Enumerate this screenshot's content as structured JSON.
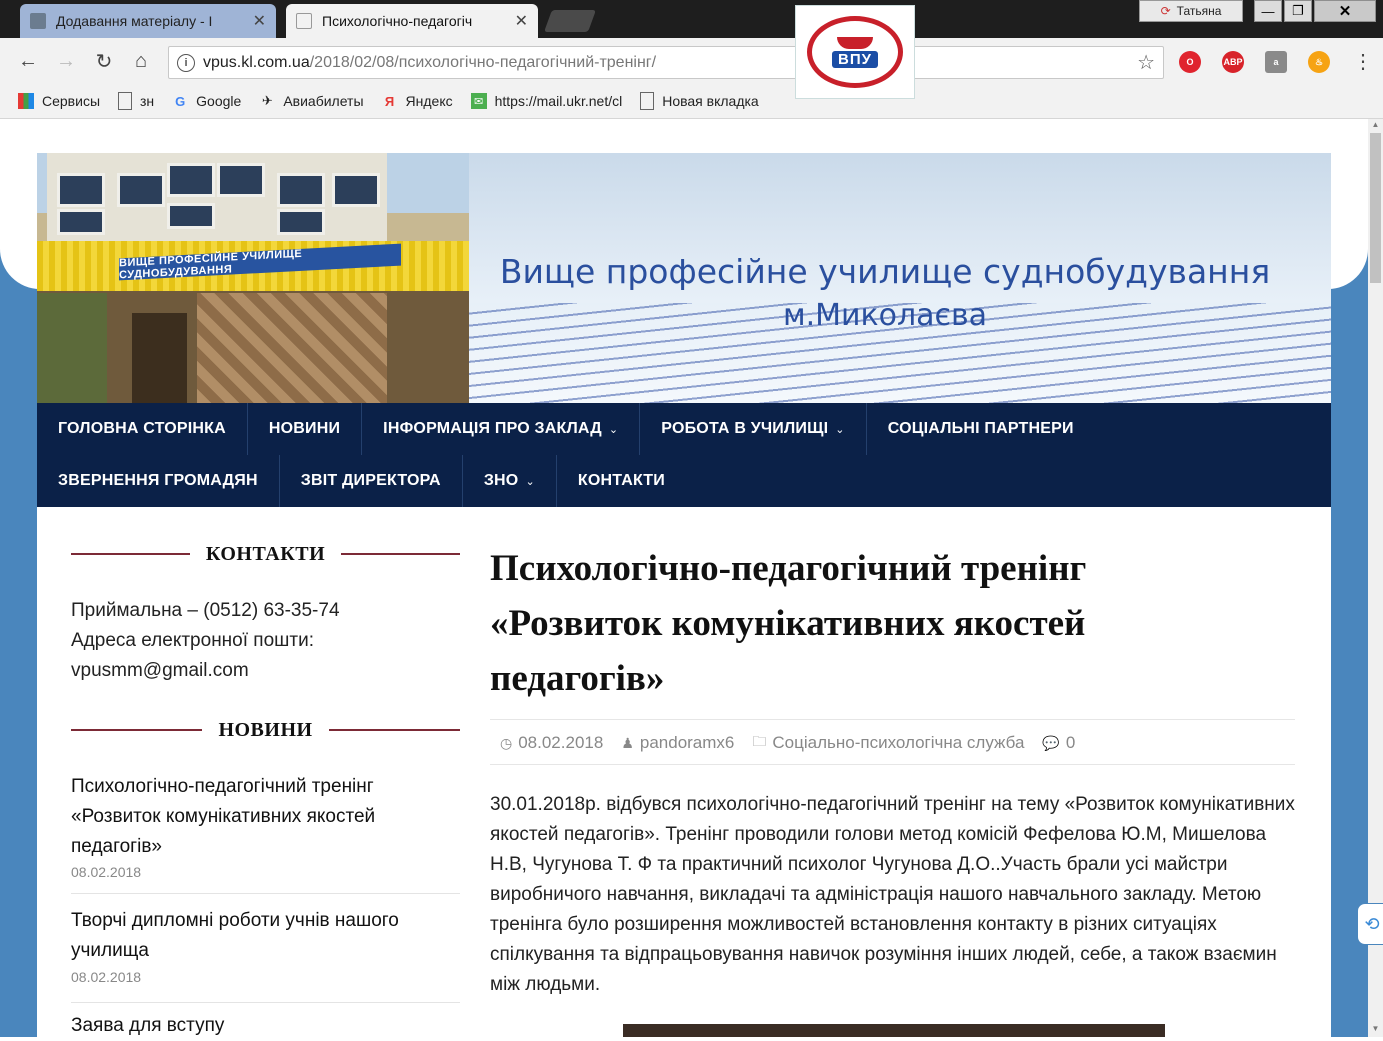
{
  "browser": {
    "tabs": [
      {
        "title": "Додавання матеріалу - І",
        "close": "✕"
      },
      {
        "title": "Психологічно-педагогіч",
        "close": "✕"
      }
    ],
    "user": "Татьяна",
    "window_buttons": {
      "minimize": "—",
      "maximize": "❐",
      "close": "✕"
    },
    "url_host": "vpus.kl.com.ua",
    "url_path": "/2018/02/08/психологічно-педагогічний-тренінг/",
    "extensions": {
      "adblock": "ABP"
    },
    "bookmarks": [
      {
        "label": "Сервисы",
        "icon": "apps-grid-icon"
      },
      {
        "label": "зн",
        "icon": "page-icon"
      },
      {
        "label": "Google",
        "icon": "google-icon"
      },
      {
        "label": "Авиабилеты",
        "icon": "plane-icon"
      },
      {
        "label": "Яндекс",
        "icon": "yandex-icon"
      },
      {
        "label": "https://mail.ukr.net/cl",
        "icon": "mail-icon"
      },
      {
        "label": "Новая вкладка",
        "icon": "page-icon"
      }
    ]
  },
  "header": {
    "building_sign": "ВИЩЕ ПРОФЕСІЙНЕ УЧИЛИЩЕ СУДНОБУДУВАННЯ",
    "logo_text": "ВПУ",
    "title_line1": "Вище професійне училище суднобудування",
    "title_line2": "м.Миколаєва"
  },
  "nav": {
    "row1": [
      {
        "label": "ГОЛОВНА СТОРІНКА",
        "dropdown": false
      },
      {
        "label": "НОВИНИ",
        "dropdown": false
      },
      {
        "label": "ІНФОРМАЦІЯ ПРО ЗАКЛАД",
        "dropdown": true
      },
      {
        "label": "РОБОТА В УЧИЛИЩІ",
        "dropdown": true
      },
      {
        "label": "СОЦІАЛЬНІ ПАРТНЕРИ",
        "dropdown": false
      }
    ],
    "row2": [
      {
        "label": "ЗВЕРНЕННЯ ГРОМАДЯН",
        "dropdown": false
      },
      {
        "label": "ЗВІТ ДИРЕКТОРА",
        "dropdown": false
      },
      {
        "label": "ЗНО",
        "dropdown": true
      },
      {
        "label": "КОНТАКТИ",
        "dropdown": false
      }
    ]
  },
  "sidebar": {
    "contacts_title": "КОНТАКТИ",
    "phone": "Приймальна – (0512) 63-35-74",
    "email_label": "Адреса електронної пошти:",
    "email": "vpusmm@gmail.com",
    "news_title": "НОВИНИ",
    "news": [
      {
        "title": "Психологічно-педагогічний тренінг «Розвиток комунікативних якостей педагогів»",
        "date": "08.02.2018"
      },
      {
        "title": "Творчі дипломні роботи учнів нашого училища",
        "date": "08.02.2018"
      },
      {
        "title": "Заява для вступу",
        "date": ""
      }
    ]
  },
  "article": {
    "title": "Психологічно-педагогічний тренінг «Розвиток комунікативних якостей педагогів»",
    "date": "08.02.2018",
    "author": "pandoramx6",
    "category": "Соціально-психологічна служба",
    "comments": "0",
    "body": "30.01.2018р. відбувся психологічно-педагогічний тренінг на тему «Розвиток комунікативних якостей педагогів». Тренінг проводили голови метод комісій Фефелова Ю.М, Мишелова Н.В, Чугунова Т. Ф та практичний психолог Чугунова Д.О..Участь брали усі майстри виробничого навчання, викладачі та адміністрація нашого навчального закладу. Метою тренінга було розширення можливостей встановлення контакту в різних ситуаціях спілкування та відпрацьовування навичок розуміння інших людей, себе, а також взаємин між людьми."
  },
  "colors": {
    "nav_bg": "#0b2148",
    "page_bg": "#4a86bd",
    "widget_line": "#7c2a36",
    "banner_title": "#2a4f9e"
  }
}
